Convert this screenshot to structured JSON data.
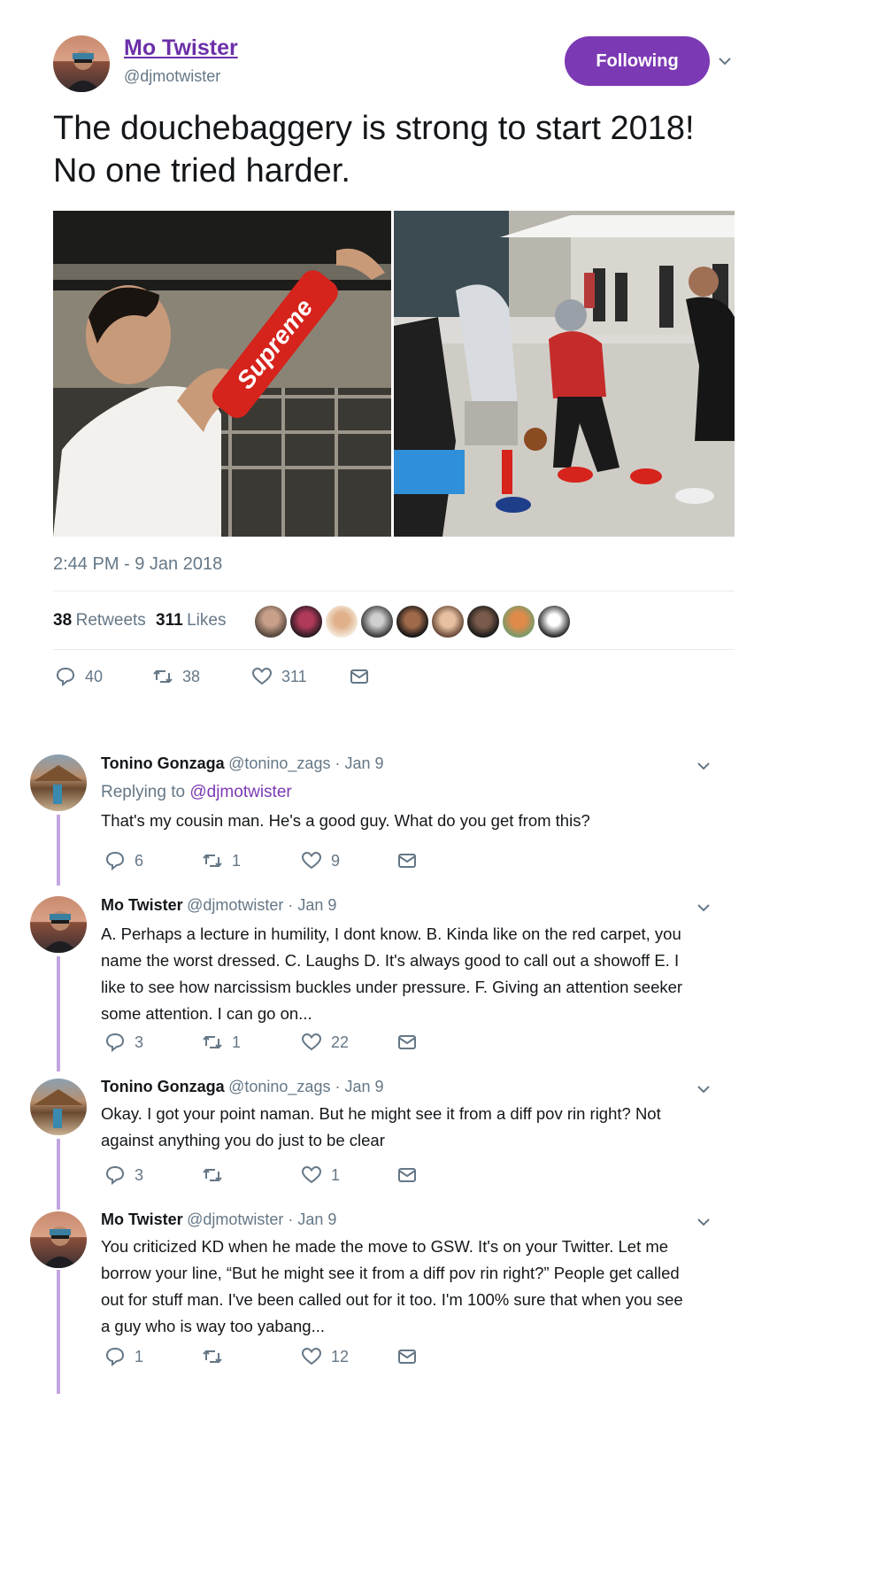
{
  "tweet": {
    "author_name": "Mo Twister",
    "author_handle": "@djmotwister",
    "follow_label": "Following",
    "text_line1": "The douchebaggery is strong to start 2018!",
    "text_line2": "No one tried harder.",
    "image_left_text": "Supreme",
    "timestamp": "2:44 PM - 9 Jan 2018",
    "retweets_count": "38",
    "retweets_label": "Retweets",
    "likes_count": "311",
    "likes_label": "Likes",
    "actions": {
      "replies": "40",
      "retweets": "38",
      "likes": "311"
    }
  },
  "replies": [
    {
      "name": "Tonino Gonzaga",
      "handle": "@tonino_zags · Jan 9",
      "replying_prefix": "Replying to ",
      "replying_to": "@djmotwister",
      "lines": [
        "That's my cousin man. He's a good guy. What do you get from this?"
      ],
      "replies": "6",
      "retweets": "1",
      "likes": "9"
    },
    {
      "name": "Mo Twister",
      "handle": "@djmotwister · Jan 9",
      "lines": [
        "A. Perhaps a lecture in humility, I dont know. B. Kinda like on the red carpet, you",
        "name the worst dressed. C. Laughs D. It's always good to call out a showoff E. I",
        "like to see how narcissism buckles under pressure. F. Giving an attention seeker",
        "some attention. I can go on..."
      ],
      "replies": "3",
      "retweets": "1",
      "likes": "22"
    },
    {
      "name": "Tonino Gonzaga",
      "handle": "@tonino_zags · Jan 9",
      "lines": [
        "Okay. I got your point naman. But he might see it from a diff pov rin right? Not",
        "against anything you do just to be clear"
      ],
      "replies": "3",
      "retweets": "",
      "likes": "1"
    },
    {
      "name": "Mo Twister",
      "handle": "@djmotwister · Jan 9",
      "lines": [
        "You criticized KD when he made the move to GSW. It's on your Twitter. Let me",
        "borrow your line, “But he might see it from a diff pov rin right?” People get called",
        "out for stuff man. I've been called out for it too. I'm 100% sure that when you see",
        "a guy who is way too yabang..."
      ],
      "replies": "1",
      "retweets": "",
      "likes": "12"
    }
  ],
  "colors": {
    "accent": "#7c39b4",
    "thread": "#c3a6e0",
    "muted": "#657786",
    "supreme_red": "#d6231c"
  }
}
